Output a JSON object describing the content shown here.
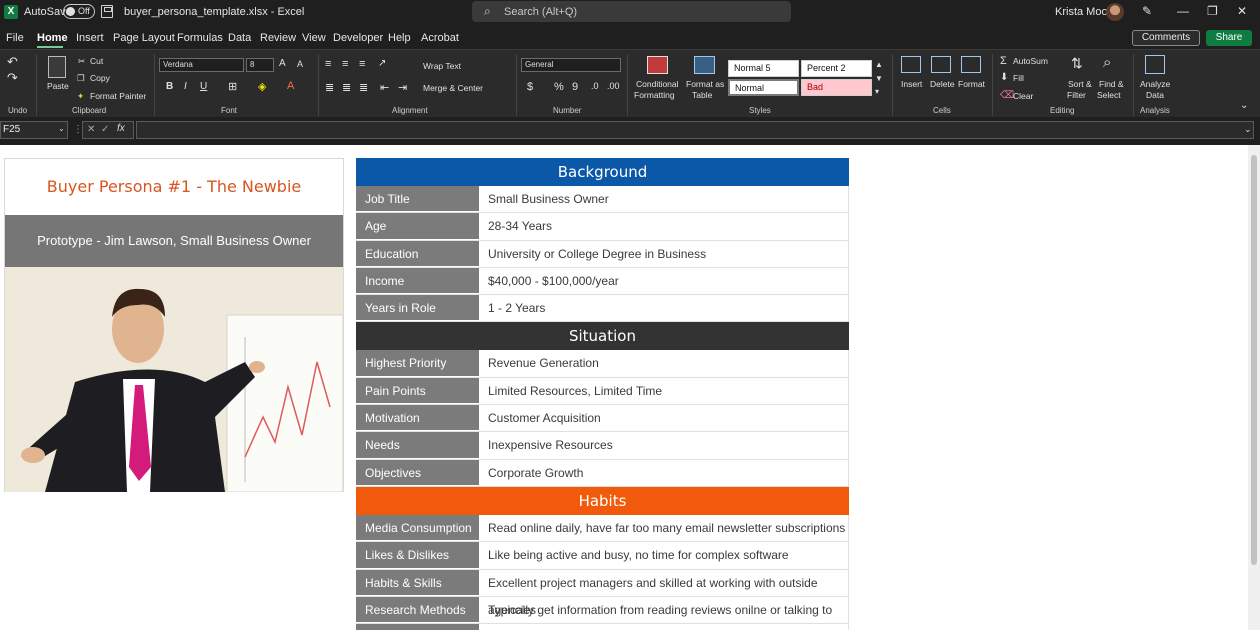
{
  "titlebar": {
    "logo": "X",
    "autosave_label": "AutoSave",
    "autosave_state": "Off",
    "filename": "buyer_persona_template.xlsx  -  Excel",
    "search_placeholder": "Search (Alt+Q)",
    "user_name": "Krista Moon",
    "minimize": "—",
    "restore": "❐",
    "close": "✕"
  },
  "menu": {
    "tabs": [
      "File",
      "Home",
      "Insert",
      "Page Layout",
      "Formulas",
      "Data",
      "Review",
      "View",
      "Developer",
      "Help",
      "Acrobat"
    ],
    "comments": "Comments",
    "share": "Share"
  },
  "ribbon": {
    "undo_group": "Undo",
    "clipboard": {
      "label": "Clipboard",
      "paste": "Paste",
      "cut": "Cut",
      "copy": "Copy",
      "format_painter": "Format Painter"
    },
    "font": {
      "label": "Font",
      "name": "Verdana",
      "size": "8"
    },
    "alignment": {
      "label": "Alignment",
      "wrap": "Wrap Text",
      "merge": "Merge & Center"
    },
    "number": {
      "label": "Number",
      "format": "General"
    },
    "styles": {
      "label": "Styles",
      "cond": "Conditional",
      "cond2": "Formatting",
      "table": "Format as",
      "table2": "Table",
      "normal5": "Normal 5",
      "percent2": "Percent 2",
      "normal": "Normal",
      "bad": "Bad"
    },
    "cells": {
      "label": "Cells",
      "insert": "Insert",
      "delete": "Delete",
      "format": "Format"
    },
    "editing": {
      "label": "Editing",
      "autosum": "AutoSum",
      "fill": "Fill",
      "clear": "Clear",
      "sort": "Sort &",
      "sort2": "Filter",
      "find": "Find &",
      "find2": "Select"
    },
    "analysis": {
      "label": "Analysis",
      "analyze": "Analyze",
      "analyze2": "Data"
    }
  },
  "formulabar": {
    "cell_ref": "F25",
    "fx": "fx"
  },
  "persona": {
    "title": "Buyer Persona #1 - The Newbie",
    "subtitle": "Prototype - Jim Lawson, Small Business Owner"
  },
  "sections": {
    "background": {
      "title": "Background",
      "color": "#0b58a8",
      "rows": [
        {
          "k": "Job Title",
          "v": "Small Business Owner"
        },
        {
          "k": "Age",
          "v": "28-34 Years"
        },
        {
          "k": "Education",
          "v": "University or College Degree in Business"
        },
        {
          "k": "Income",
          "v": "$40,000 - $100,000/year"
        },
        {
          "k": "Years in Role",
          "v": "1 - 2 Years"
        }
      ]
    },
    "situation": {
      "title": "Situation",
      "color": "#333333",
      "rows": [
        {
          "k": "Highest Priority",
          "v": "Revenue Generation"
        },
        {
          "k": "Pain Points",
          "v": "Limited Resources, Limited Time"
        },
        {
          "k": "Motivation",
          "v": "Customer Acquisition"
        },
        {
          "k": "Needs",
          "v": "Inexpensive Resources"
        },
        {
          "k": "Objectives",
          "v": "Corporate Growth"
        }
      ]
    },
    "habits": {
      "title": "Habits",
      "color": "#f05a0a",
      "rows": [
        {
          "k": "Media Consumption",
          "v": "Read online daily, have far too many email newsletter subscriptions"
        },
        {
          "k": "Likes & Dislikes",
          "v": "Like being active and busy, no time for complex software"
        },
        {
          "k": "Habits & Skills",
          "v": "Excellent project managers and skilled at working with outside agencies"
        },
        {
          "k": "Research Methods",
          "v": "Typically get information from reading reviews onilne or talking to peers"
        }
      ]
    }
  }
}
